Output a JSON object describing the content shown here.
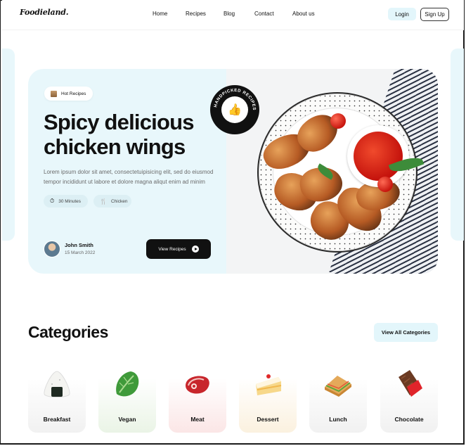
{
  "brand": {
    "logo": "Foodieland."
  },
  "nav": {
    "items": [
      "Home",
      "Recipes",
      "Blog",
      "Contact",
      "About us"
    ]
  },
  "auth": {
    "login": "Login",
    "signup": "Sign Up"
  },
  "hero": {
    "badge": "Hot Recipes",
    "title_line1": "Spicy delicious",
    "title_line2": "chicken wings",
    "description": "Lorem ipsum dolor sit amet, consectetuipisicing elit, sed do eiusmod tempor incididunt ut labore et dolore magna aliqut enim ad minim",
    "time": "30 Minutes",
    "category": "Chicken",
    "author": "John Smith",
    "date": "15 March 2022",
    "cta": "View Recipes",
    "stamp_text": "HANDPICKED RECIPES"
  },
  "categories": {
    "title": "Categories",
    "view_all": "View All Categories",
    "items": [
      {
        "label": "Breakfast",
        "icon": "onigiri-icon",
        "bg": "#f3f3f3"
      },
      {
        "label": "Vegan",
        "icon": "lettuce-icon",
        "bg": "#eef5ea"
      },
      {
        "label": "Meat",
        "icon": "steak-icon",
        "bg": "#fbeaea"
      },
      {
        "label": "Dessert",
        "icon": "cake-icon",
        "bg": "#fbf3e6"
      },
      {
        "label": "Lunch",
        "icon": "sandwich-icon",
        "bg": "#f3f3f3"
      },
      {
        "label": "Chocolate",
        "icon": "chocolate-icon",
        "bg": "#f3f3f3"
      }
    ]
  },
  "colors": {
    "accent": "#e8f7fb",
    "dark": "#111111"
  }
}
